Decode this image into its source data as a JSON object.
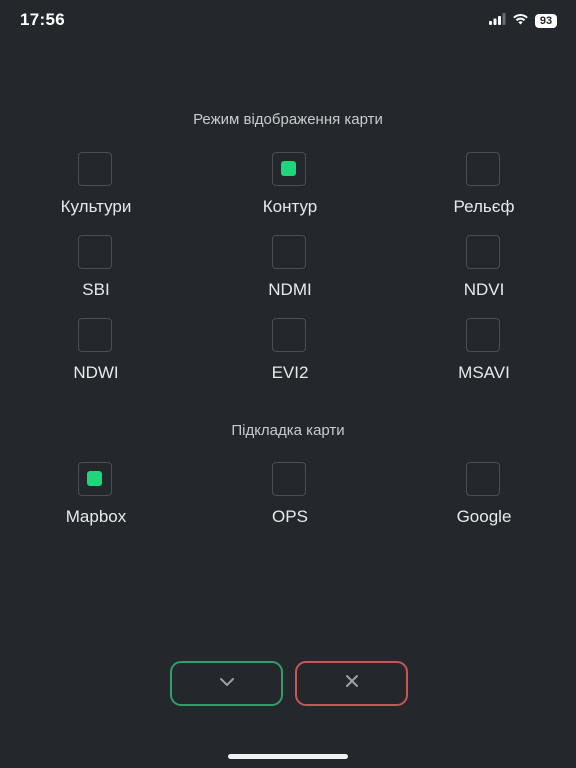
{
  "status_bar": {
    "time": "17:56",
    "battery": "93",
    "icons": [
      "cellular-signal-icon",
      "wifi-icon",
      "battery-icon"
    ]
  },
  "map_mode": {
    "title": "Режим відображення карти",
    "options": [
      {
        "label": "Культури",
        "checked": false
      },
      {
        "label": "Контур",
        "checked": true
      },
      {
        "label": "Рельєф",
        "checked": false
      },
      {
        "label": "SBI",
        "checked": false
      },
      {
        "label": "NDMI",
        "checked": false
      },
      {
        "label": "NDVI",
        "checked": false
      },
      {
        "label": "NDWI",
        "checked": false
      },
      {
        "label": "EVI2",
        "checked": false
      },
      {
        "label": "MSAVI",
        "checked": false
      }
    ]
  },
  "base_layer": {
    "title": "Підкладка карти",
    "options": [
      {
        "label": "Mapbox",
        "checked": true
      },
      {
        "label": "OPS",
        "checked": false
      },
      {
        "label": "Google",
        "checked": false
      }
    ]
  },
  "actions": {
    "confirm_icon": "chevron-down-icon",
    "cancel_icon": "close-icon"
  },
  "colors": {
    "background": "#24272b",
    "accent_green": "#1fd67a",
    "confirm_border": "#2f9e67",
    "cancel_border": "#c95555"
  }
}
